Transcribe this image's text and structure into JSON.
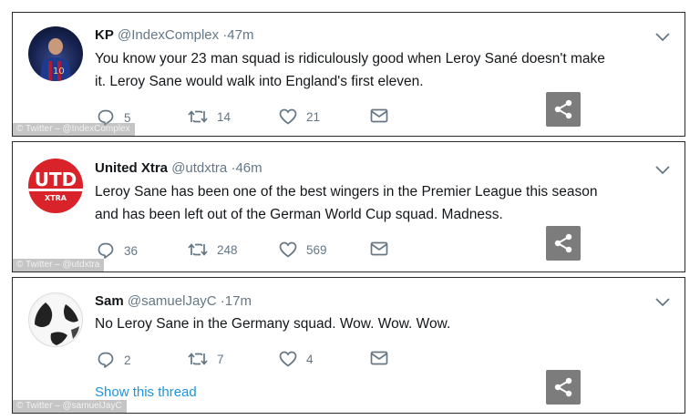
{
  "colors": {
    "link": "#1b95e0",
    "meta": "#657786",
    "share_bg": "#7c7c7c",
    "utd_red": "#d8232a"
  },
  "tweets": [
    {
      "name": "KP",
      "handle": "@IndexComplex",
      "time": "·47m",
      "text_lines": [
        "You know your 23 man squad is ridiculously good when Leroy Sané doesn't make",
        "it. Leroy Sane would walk into England's first eleven."
      ],
      "replies": "5",
      "retweets": "14",
      "likes": "21",
      "watermark": "© Twitter – @IndexComplex"
    },
    {
      "name": "United Xtra",
      "handle": "@utdxtra",
      "time": "·46m",
      "text_lines": [
        "Leroy Sane has been one of the best wingers in the Premier League this season",
        "and has been left out of the German World Cup squad. Madness."
      ],
      "replies": "36",
      "retweets": "248",
      "likes": "569",
      "watermark": "© Twitter – @utdxtra",
      "avatar_logo": {
        "top": "UTD",
        "bottom": "XTRA"
      }
    },
    {
      "name": "Sam",
      "handle": "@samuelJayC",
      "time": "·17m",
      "text_lines": [
        "No Leroy Sane in the Germany squad. Wow. Wow. Wow."
      ],
      "replies": "2",
      "retweets": "7",
      "likes": "4",
      "show_thread": "Show this thread",
      "watermark": "© Twitter – @samuelJayC"
    }
  ]
}
